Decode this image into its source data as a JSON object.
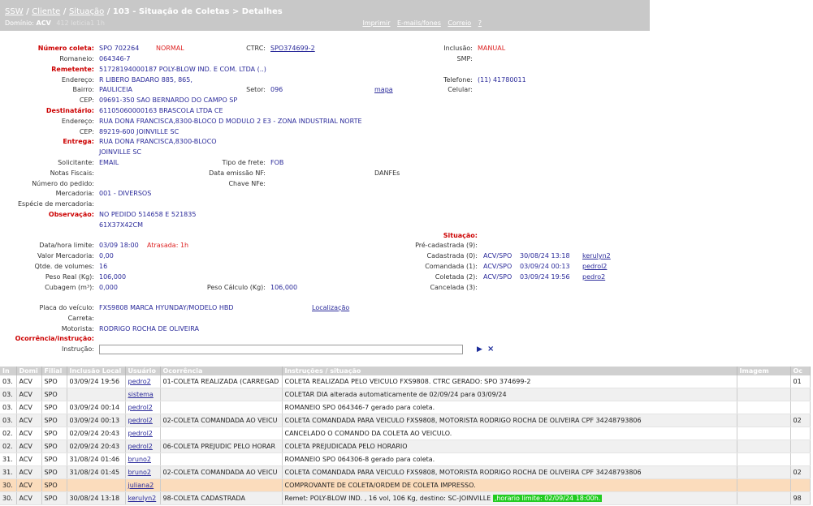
{
  "header": {
    "breadcrumb": [
      "SSW",
      "Cliente",
      "Situação"
    ],
    "title": "103 - Situação de Coletas > Detalhes",
    "domain_label": "Domínio:",
    "domain_value": "ACV",
    "domain_faint": "412 leticia1 1h",
    "links": [
      "Imprimir",
      "E-mails/fones",
      "Correio",
      "?"
    ]
  },
  "details": {
    "numero_coleta": {
      "label": "Número coleta:",
      "value": "SPO 702264",
      "status": "NORMAL"
    },
    "ctrc": {
      "label": "CTRC:",
      "value": "SPO374699-2"
    },
    "inclusao": {
      "label": "Inclusão:",
      "value": "MANUAL"
    },
    "smp": {
      "label": "SMP:"
    },
    "romaneio": {
      "label": "Romaneio:",
      "value": "064346-7"
    },
    "remetente": {
      "label": "Remetente:",
      "value": "51728194000187 POLY-BLOW IND. E COM. LTDA (..)"
    },
    "endereco1": {
      "label": "Endereço:",
      "value": "R LIBERO BADARO 885, 865,"
    },
    "telefone": {
      "label": "Telefone:",
      "value": "(11) 41780011"
    },
    "bairro": {
      "label": "Bairro:",
      "value": "PAULICEIA"
    },
    "setor": {
      "label": "Setor:",
      "value": "096"
    },
    "mapa": "mapa",
    "celular": {
      "label": "Celular:"
    },
    "cep1": {
      "label": "CEP:",
      "value": "09691-350 SAO BERNARDO DO CAMPO SP"
    },
    "destinatario": {
      "label": "Destinatário:",
      "value": "61105060000163 BRASCOLA LTDA CE"
    },
    "endereco2": {
      "label": "Endereço:",
      "value": "RUA DONA FRANCISCA,8300-BLOCO D MODULO 2 E3 - ZONA INDUSTRIAL NORTE"
    },
    "cep2": {
      "label": "CEP:",
      "value": "89219-600 JOINVILLE SC"
    },
    "entrega": {
      "label": "Entrega:",
      "value1": "RUA DONA FRANCISCA,8300-BLOCO",
      "value2": "JOINVILLE SC"
    },
    "solicitante": {
      "label": "Solicitante:",
      "value": "EMAIL"
    },
    "tipo_frete": {
      "label": "Tipo de frete:",
      "value": "FOB"
    },
    "notas_fiscais": {
      "label": "Notas Fiscais:"
    },
    "data_emissao_nf": {
      "label": "Data emissão NF:"
    },
    "danfes": "DANFEs",
    "numero_pedido": {
      "label": "Número do pedido:"
    },
    "chave_nfe": {
      "label": "Chave NFe:"
    },
    "mercadoria": {
      "label": "Mercadoria:",
      "value": "001 - DIVERSOS"
    },
    "especie": {
      "label": "Espécie de mercadoria:"
    },
    "observacao": {
      "label": "Observação:",
      "value1": "NO PEDIDO 514658 E 521835",
      "value2": "61X37X42CM"
    },
    "data_hora_limite": {
      "label": "Data/hora limite:",
      "value": "03/09 18:00",
      "late": "Atrasada: 1h"
    },
    "valor_mercadoria": {
      "label": "Valor Mercadoria:",
      "value": "0,00"
    },
    "qtde_volumes": {
      "label": "Qtde. de volumes:",
      "value": "16"
    },
    "peso_real": {
      "label": "Peso Real (Kg):",
      "value": "106,000"
    },
    "cubagem": {
      "label": "Cubagem (m³):",
      "value": "0,000"
    },
    "peso_calculo": {
      "label": "Peso Cálculo (Kg):",
      "value": "106,000"
    },
    "situacao": {
      "label": "Situação:",
      "pre": {
        "label": "Pré-cadastrada (9):"
      },
      "cadastrada": {
        "label": "Cadastrada (0):",
        "unit": "ACV/SPO",
        "datetime": "30/08/24 13:18",
        "user": "kerulyn2"
      },
      "comandada": {
        "label": "Comandada (1):",
        "unit": "ACV/SPO",
        "datetime": "03/09/24 00:13",
        "user": "pedrol2"
      },
      "coletada": {
        "label": "Coletada (2):",
        "unit": "ACV/SPO",
        "datetime": "03/09/24 19:56",
        "user": "pedro2"
      },
      "cancelada": {
        "label": "Cancelada (3):"
      }
    },
    "placa": {
      "label": "Placa do veículo:",
      "value": "FXS9808 MARCA HYUNDAY/MODELO HBD",
      "link": "Localização"
    },
    "carreta": {
      "label": "Carreta:"
    },
    "motorista": {
      "label": "Motorista:",
      "value": "RODRIGO ROCHA DE OLIVEIRA"
    },
    "ocorrencia_label": "Ocorrência/instrução:",
    "instrucao_label": "Instrução:",
    "instrucao_value": "",
    "instrucao_placeholder": ""
  },
  "table": {
    "headers": [
      "In",
      "Domi",
      "Filial",
      "Inclusão Local",
      "Usuário",
      "Ocorrência",
      "Instruções / situação",
      "Imagem",
      "Oc"
    ],
    "rows": [
      {
        "in": "03.",
        "dom": "ACV",
        "filial": "SPO",
        "inclusao": "03/09/24 19:56",
        "usuario": "pedro2",
        "ocorrencia": "01-COLETA REALIZADA (CARREGAD",
        "instr": "COLETA REALIZADA PELO VEICULO FXS9808. CTRC GERADO: SPO 374699-2",
        "imagem": "",
        "oc": "01",
        "style": "odd"
      },
      {
        "in": "03.",
        "dom": "ACV",
        "filial": "SPO",
        "inclusao": "",
        "usuario": "sistema",
        "ocorrencia": "",
        "instr": "COLETAR DIA alterada automaticamente de 02/09/24 para 03/09/24",
        "imagem": "",
        "oc": "",
        "style": "even"
      },
      {
        "in": "03.",
        "dom": "ACV",
        "filial": "SPO",
        "inclusao": "03/09/24 00:14",
        "usuario": "pedrol2",
        "ocorrencia": "",
        "instr": "ROMANEIO SPO 064346-7 gerado para coleta.",
        "imagem": "",
        "oc": "",
        "style": "odd"
      },
      {
        "in": "03.",
        "dom": "ACV",
        "filial": "SPO",
        "inclusao": "03/09/24 00:13",
        "usuario": "pedrol2",
        "ocorrencia": "02-COLETA COMANDADA AO VEICU",
        "instr": "COLETA COMANDADA PARA VEICULO FXS9808, MOTORISTA RODRIGO ROCHA DE OLIVEIRA CPF 34248793806",
        "imagem": "",
        "oc": "02",
        "style": "even"
      },
      {
        "in": "02.",
        "dom": "ACV",
        "filial": "SPO",
        "inclusao": "02/09/24 20:43",
        "usuario": "pedrol2",
        "ocorrencia": "",
        "instr": "CANCELADO O COMANDO DA COLETA AO VEICULO.",
        "imagem": "",
        "oc": "",
        "style": "odd"
      },
      {
        "in": "02.",
        "dom": "ACV",
        "filial": "SPO",
        "inclusao": "02/09/24 20:43",
        "usuario": "pedrol2",
        "ocorrencia": "06-COLETA PREJUDIC PELO HORAR",
        "instr": "COLETA PREJUDICADA PELO HORARIO",
        "imagem": "",
        "oc": "",
        "style": "even"
      },
      {
        "in": "31.",
        "dom": "ACV",
        "filial": "SPO",
        "inclusao": "31/08/24 01:46",
        "usuario": "bruno2",
        "ocorrencia": "",
        "instr": "ROMANEIO SPO 064306-8 gerado para coleta.",
        "imagem": "",
        "oc": "",
        "style": "odd"
      },
      {
        "in": "31.",
        "dom": "ACV",
        "filial": "SPO",
        "inclusao": "31/08/24 01:45",
        "usuario": "bruno2",
        "ocorrencia": "02-COLETA COMANDADA AO VEICU",
        "instr": "COLETA COMANDADA PARA VEICULO FXS9808, MOTORISTA RODRIGO ROCHA DE OLIVEIRA CPF 34248793806",
        "imagem": "",
        "oc": "02",
        "style": "even"
      },
      {
        "in": "30.",
        "dom": "ACV",
        "filial": "SPO",
        "inclusao": "",
        "usuario": "juliana2",
        "ocorrencia": "",
        "instr": "COMPROVANTE DE COLETA/ORDEM DE COLETA IMPRESSO.",
        "imagem": "",
        "oc": "",
        "style": "hl"
      },
      {
        "in": "30.",
        "dom": "ACV",
        "filial": "SPO",
        "inclusao": "30/08/24 13:18",
        "usuario": "kerulyn2",
        "ocorrencia": "98-COLETA CADASTRADA",
        "instr": "Remet: POLY-BLOW IND. , 16 vol, 106 Kg, destino: SC-JOINVILLE",
        "instr_green": ",horario limite: 02/09/24 18:00h.",
        "imagem": "",
        "oc": "98",
        "style": "even"
      }
    ]
  }
}
